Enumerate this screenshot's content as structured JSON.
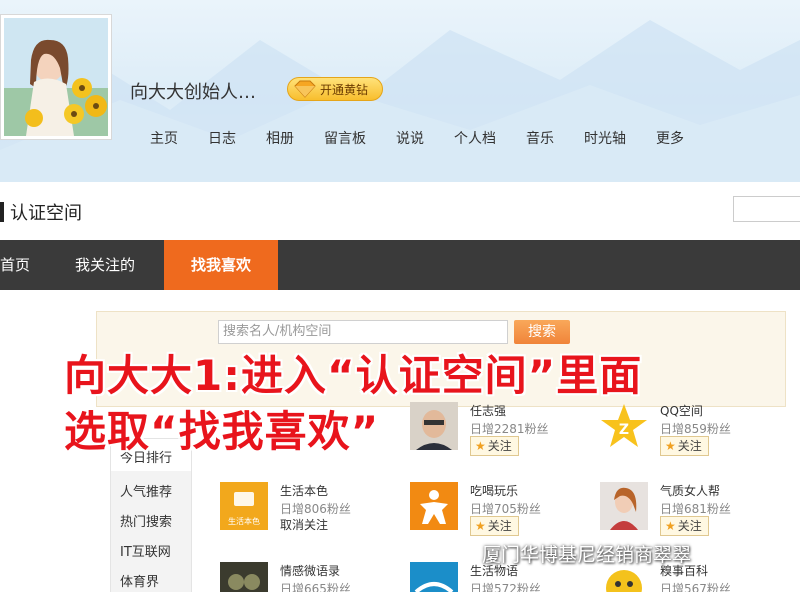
{
  "profile": {
    "name": "向大大创始人…",
    "vip_label": "开通黄钻"
  },
  "nav": [
    "主页",
    "日志",
    "相册",
    "留言板",
    "说说",
    "个人档",
    "音乐",
    "时光轴",
    "更多"
  ],
  "cert": {
    "title": "认证空间"
  },
  "tabs": {
    "home": "首页",
    "following": "我关注的",
    "find": "找我喜欢"
  },
  "search": {
    "placeholder": "搜索名人/机构空间",
    "button": "搜索"
  },
  "sidebar": [
    "今日排行",
    "人气推荐",
    "热门搜索",
    "IT互联网",
    "体育界"
  ],
  "follow_label": "关注",
  "cards": [
    {
      "name": "任志强",
      "fans": "日增2281粉丝",
      "action": "关注"
    },
    {
      "name": "QQ空间",
      "fans": "日增859粉丝",
      "action": "关注"
    },
    {
      "name": "生活本色",
      "fans": "日增806粉丝",
      "action": "取消关注",
      "thumb_text": "生活本色"
    },
    {
      "name": "吃喝玩乐",
      "fans": "日增705粉丝",
      "action": "关注"
    },
    {
      "name": "气质女人帮",
      "fans": "日增681粉丝",
      "action": "关注"
    },
    {
      "name": "情感微语录",
      "fans": "日增665粉丝"
    },
    {
      "name": "生活物语",
      "fans": "日增572粉丝"
    },
    {
      "name": "糗事百科",
      "fans": "日增567粉丝"
    }
  ],
  "overlay": {
    "line1": "向大大1:进入“认证空间”里面",
    "line2": "选取“找我喜欢”"
  },
  "watermark": "厦门华博基尼经销商翠翠",
  "colors": {
    "accent": "#ef6a1e",
    "tabbar": "#3a3a3a",
    "overlay_text": "#e8141c"
  }
}
